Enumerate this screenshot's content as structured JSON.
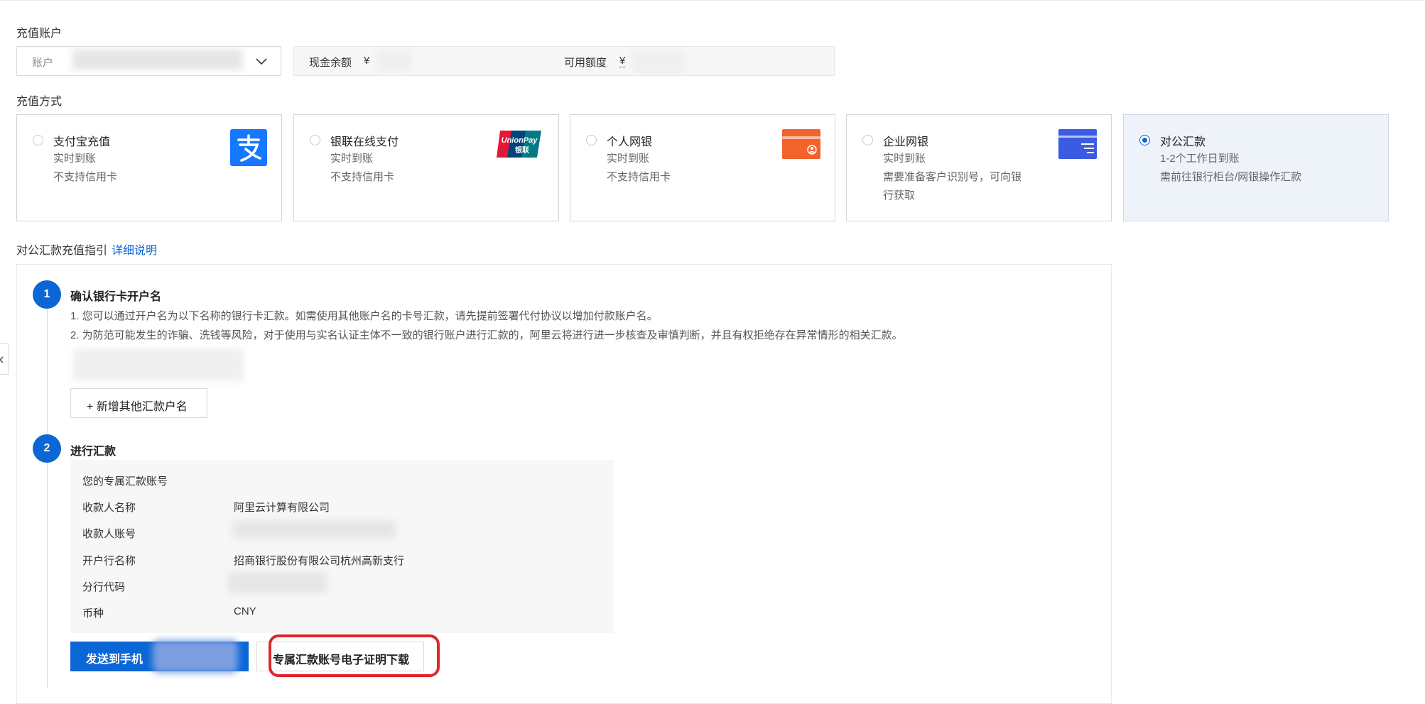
{
  "recharge_account": {
    "section_label": "充值账户",
    "account_label": "账户",
    "cash_balance_label": "现金余额",
    "cash_balance_currency": "¥",
    "available_credit_label": "可用额度",
    "available_credit_currency": "¥"
  },
  "recharge_method": {
    "section_label": "充值方式",
    "options": [
      {
        "title": "支付宝充值",
        "lines": [
          "实时到账",
          "不支持信用卡"
        ],
        "selected": false,
        "icon": "alipay-logo"
      },
      {
        "title": "银联在线支付",
        "lines": [
          "实时到账",
          "不支持信用卡"
        ],
        "selected": false,
        "icon": "unionpay-logo",
        "logo_text_1": "UnionPay",
        "logo_text_2": "银联"
      },
      {
        "title": "个人网银",
        "lines": [
          "实时到账",
          "不支持信用卡"
        ],
        "selected": false,
        "icon": "personal-card-icon"
      },
      {
        "title": "企业网银",
        "lines": [
          "实时到账",
          "需要准备客户识别号，可向银",
          "行获取"
        ],
        "selected": false,
        "icon": "enterprise-card-icon"
      },
      {
        "title": "对公汇款",
        "lines": [
          "1-2个工作日到账",
          "需前往银行柜台/网银操作汇款"
        ],
        "selected": true,
        "icon": ""
      }
    ]
  },
  "guide": {
    "title": "对公汇款充值指引",
    "link": "详细说明",
    "step1": {
      "number": "1",
      "title": "确认银行卡开户名",
      "note1": "1. 您可以通过开户名为以下名称的银行卡汇款。如需使用其他账户名的卡号汇款，请先提前签署代付协议以增加付款账户名。",
      "note2": "2. 为防范可能发生的诈骗、洗钱等风险，对于使用与实名认证主体不一致的银行账户进行汇款的，阿里云将进行进一步核查及审慎判断，并且有权拒绝存在异常情形的相关汇款。",
      "add_button": "+ 新增其他汇款户名"
    },
    "step2": {
      "number": "2",
      "title": "进行汇款",
      "panel_title": "您的专属汇款账号",
      "rows": [
        {
          "label": "收款人名称",
          "value": "阿里云计算有限公司"
        },
        {
          "label": "收款人账号",
          "value": ""
        },
        {
          "label": "开户行名称",
          "value": "招商银行股份有限公司杭州高新支行"
        },
        {
          "label": "分行代码",
          "value": ""
        },
        {
          "label": "币种",
          "value": "CNY"
        }
      ],
      "send_button": "发送到手机",
      "download_button": "专属汇款账号电子证明下载"
    }
  },
  "colors": {
    "primary": "#0b66d6",
    "highlight_outline": "#e0262c",
    "alipay": "#1677ff",
    "personal_card": "#f2632b",
    "enterprise_card": "#3b5be0"
  }
}
